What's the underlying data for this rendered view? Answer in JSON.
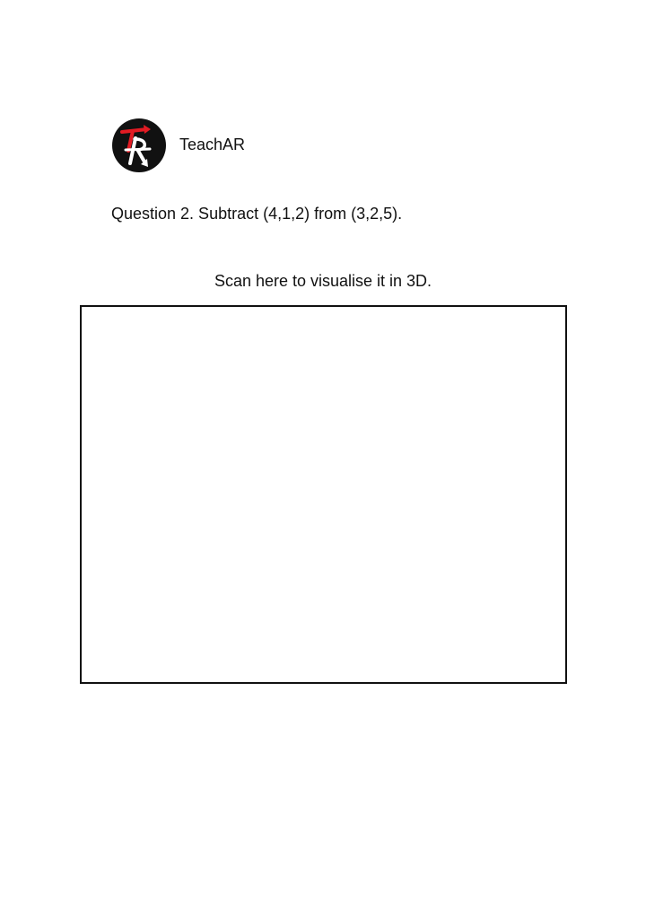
{
  "header": {
    "logo_icon": "teachar-logo-icon",
    "brand_name": "TeachAR"
  },
  "question": {
    "text": "Question 2. Subtract (4,1,2) from (3,2,5)."
  },
  "scan": {
    "caption": "Scan here to visualise it in 3D."
  },
  "colors": {
    "logo_background": "#111111",
    "logo_accent": "#e31b23",
    "logo_foreground": "#ffffff",
    "text": "#111111",
    "border": "#111111"
  }
}
